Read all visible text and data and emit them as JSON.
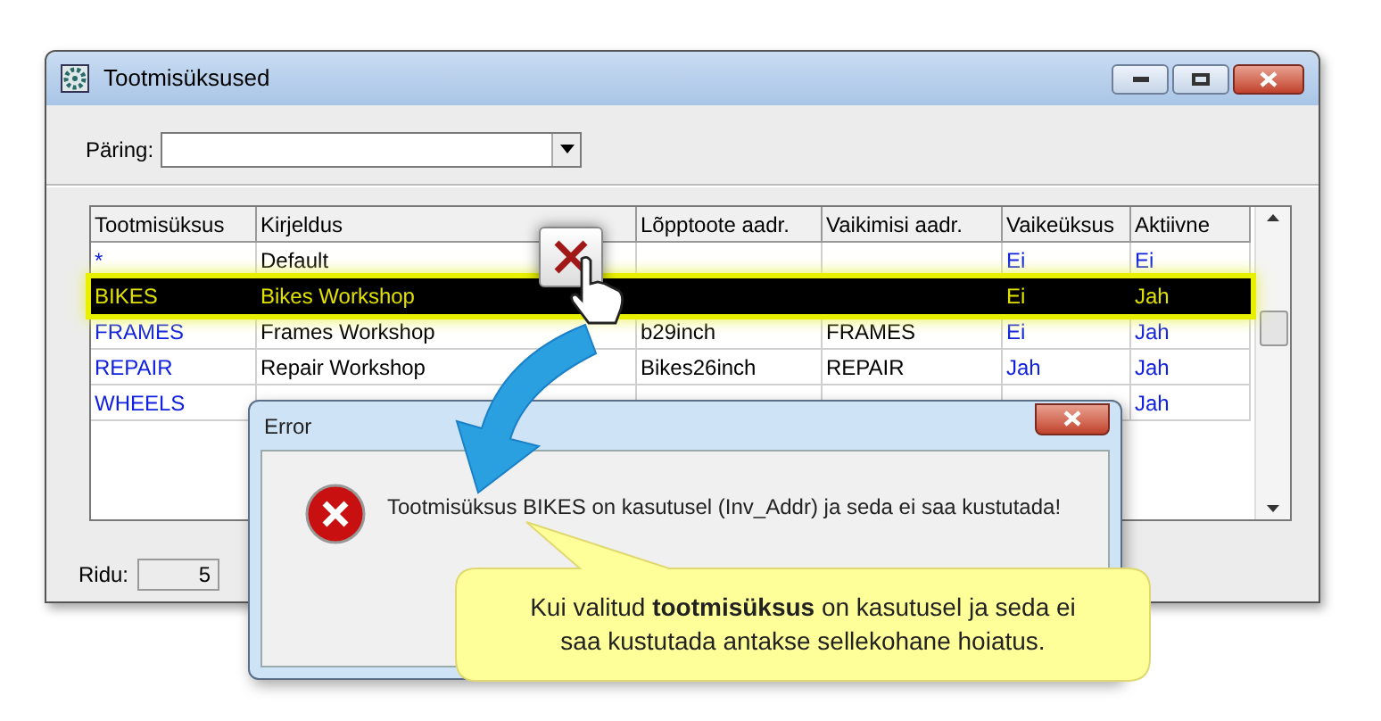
{
  "window": {
    "title": "Tootmisüksused"
  },
  "query": {
    "label": "Päring:"
  },
  "table": {
    "columns": [
      "Tootmisüksus",
      "Kirjeldus",
      "Lõpptoote aadr.",
      "Vaikimisi aadr.",
      "Vaikeüksus",
      "Aktiivne"
    ],
    "rows": [
      {
        "selected": false,
        "cells": [
          "*",
          "Default",
          "",
          "",
          "Ei",
          "Ei"
        ]
      },
      {
        "selected": true,
        "cells": [
          "BIKES",
          "Bikes Workshop",
          "",
          "",
          "Ei",
          "Jah"
        ]
      },
      {
        "selected": false,
        "cells": [
          "FRAMES",
          "Frames Workshop",
          "b29inch",
          "FRAMES",
          "Ei",
          "Jah"
        ]
      },
      {
        "selected": false,
        "cells": [
          "REPAIR",
          "Repair Workshop",
          "Bikes26inch",
          "REPAIR",
          "Jah",
          "Jah"
        ]
      },
      {
        "selected": false,
        "cells": [
          "WHEELS",
          null,
          null,
          null,
          null,
          "Jah"
        ]
      }
    ]
  },
  "status_bar": {
    "label": "Ridu:",
    "count": "5"
  },
  "error_dialog": {
    "title": "Error",
    "message": "Tootmisüksus BIKES on kasutusel (Inv_Addr) ja seda ei saa kustutada!"
  },
  "callout": {
    "text": "Kui valitud **tootmisüksus** on kasutusel ja seda ei saa kustutada antakse sellekohane hoiatus."
  }
}
